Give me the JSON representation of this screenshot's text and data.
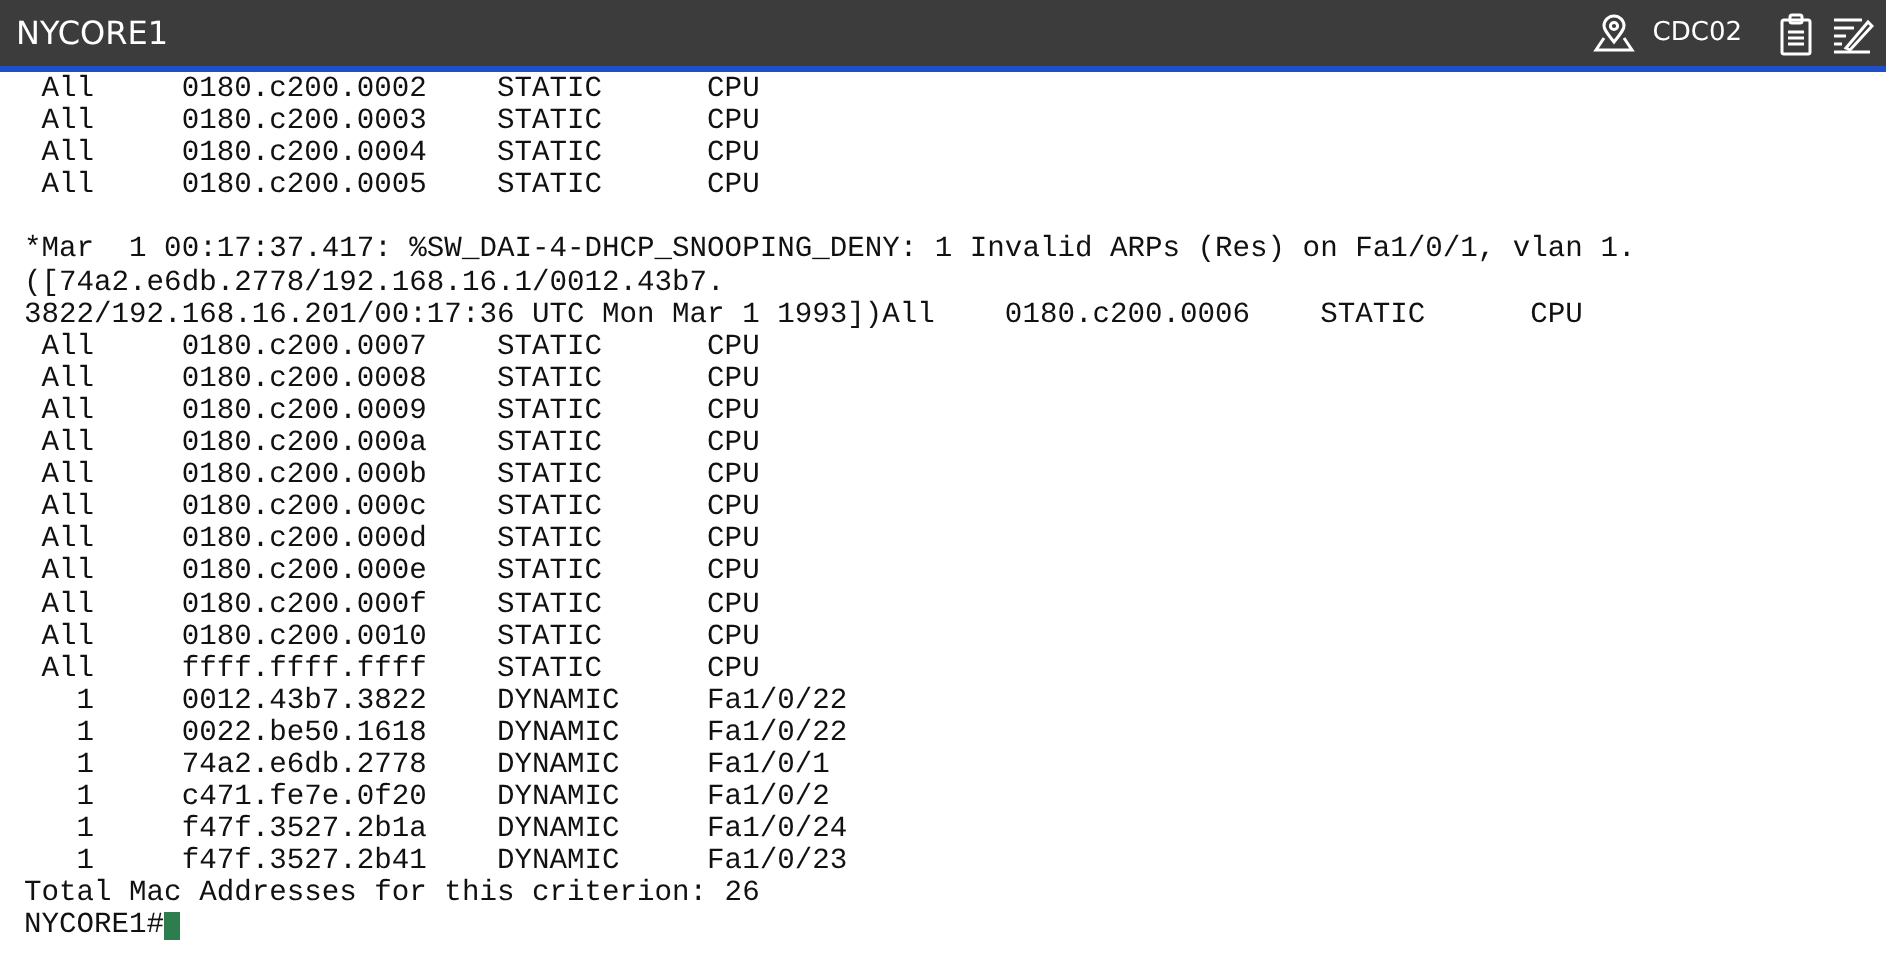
{
  "header": {
    "title": "NYCORE1",
    "site": "CDC02"
  },
  "terminal": {
    "lines": [
      " All     0180.c200.0002    STATIC      CPU",
      " All     0180.c200.0003    STATIC      CPU",
      " All     0180.c200.0004    STATIC      CPU",
      " All     0180.c200.0005    STATIC      CPU"
    ],
    "log_lines": [
      "*Mar  1 00:17:37.417: %SW_DAI-4-DHCP_SNOOPING_DENY: 1 Invalid ARPs (Res) on Fa1/0/1, vlan 1.",
      "([74a2.e6db.2778/192.168.16.1/0012.43b7.",
      "3822/192.168.16.201/00:17:36 UTC Mon Mar 1 1993])All    0180.c200.0006    STATIC      CPU",
      " All     0180.c200.0007    STATIC      CPU",
      " All     0180.c200.0008    STATIC      CPU",
      " All     0180.c200.0009    STATIC      CPU",
      " All     0180.c200.000a    STATIC      CPU",
      " All     0180.c200.000b    STATIC      CPU",
      " All     0180.c200.000c    STATIC      CPU",
      " All     0180.c200.000d    STATIC      CPU",
      " All     0180.c200.000e    STATIC      CPU",
      " All     0180.c200.000f    STATIC      CPU",
      " All     0180.c200.0010    STATIC      CPU",
      " All     ffff.ffff.ffff    STATIC      CPU",
      "   1     0012.43b7.3822    DYNAMIC     Fa1/0/22",
      "   1     0022.be50.1618    DYNAMIC     Fa1/0/22",
      "   1     74a2.e6db.2778    DYNAMIC     Fa1/0/1",
      "   1     c471.fe7e.0f20    DYNAMIC     Fa1/0/2",
      "   1     f47f.3527.2b1a    DYNAMIC     Fa1/0/24",
      "   1     f47f.3527.2b41    DYNAMIC     Fa1/0/23",
      "Total Mac Addresses for this criterion: 26"
    ],
    "prompt": "NYCORE1#"
  }
}
